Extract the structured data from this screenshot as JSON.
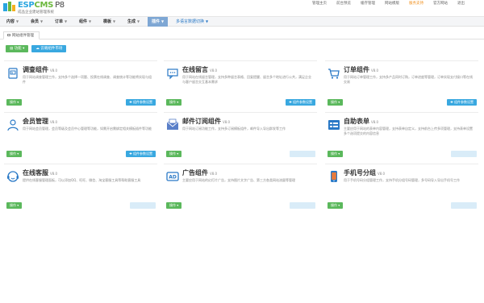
{
  "brand": {
    "logo_esp": "ESP",
    "logo_cms": "CMS",
    "logo_version": "P8",
    "subtitle": "成品企业建站管理系统"
  },
  "top_links": [
    {
      "label": "管理主页",
      "highlight": false
    },
    {
      "label": "前台预览",
      "highlight": false
    },
    {
      "label": "缓存管理",
      "highlight": false
    },
    {
      "label": "网站模版",
      "highlight": false
    },
    {
      "label": "服务支持",
      "highlight": true
    },
    {
      "label": "官方网站",
      "highlight": false
    },
    {
      "label": "退出",
      "highlight": false
    }
  ],
  "nav": {
    "items": [
      "内容",
      "会员",
      "订单",
      "组件",
      "模板",
      "生成"
    ],
    "active": "插件",
    "language": "多语言数据切换"
  },
  "tab": {
    "label": "网站组件管理"
  },
  "toolbar": {
    "primary": "功能",
    "secondary": "云端组件市场"
  },
  "cards": [
    {
      "title": "调查组件",
      "version": "V8.0",
      "desc": "用于网站调查管理工作，支持多个选择一项题、投票在线调查、调查统计等功能将实现与组件",
      "op": "操作",
      "param": "组件参数设置",
      "param_enabled": true,
      "icon": "survey-icon"
    },
    {
      "title": "在线留言",
      "version": "V8.0",
      "desc": "用于网站在线留言管理，支持多种留言表格、回复提醒、留言多个地址进行公共，满足企业与客户留言交互基本需求",
      "op": "操作",
      "param": "组件参数设置",
      "param_enabled": true,
      "icon": "message-icon"
    },
    {
      "title": "订单组件",
      "version": "V8.0",
      "desc": "用于网站订单管理工作，支持多产品同时订购，订单进度等管理，订单实现支付接口等在线交易",
      "op": "操作",
      "param": "组件参数设置",
      "param_enabled": true,
      "icon": "cart-icon"
    },
    {
      "title": "会员管理",
      "version": "V8.0",
      "desc": "用于网站会员管理，会员等级及会员中心管理等功能，如需开启需绑定相关模板插件等功能",
      "op": "操作",
      "param": "组件参数设置",
      "param_enabled": true,
      "icon": "member-icon"
    },
    {
      "title": "邮件订阅组件",
      "version": "V8.0",
      "desc": "用于网站订阅功能工作，支持多订阅模板组件，邮件导入导出群发等工作",
      "op": "操作",
      "param": "组件参数设置",
      "param_enabled": false,
      "icon": "mail-icon"
    },
    {
      "title": "自助表单",
      "version": "V8.0",
      "desc": "主要应用于网站的表单内容管理，支持表单自定义，支持前台上传多项管理，支持表单设置多个选项提交的内容信息",
      "op": "操作",
      "param": "组件参数设置",
      "param_enabled": false,
      "icon": "form-icon"
    },
    {
      "title": "在线客服",
      "version": "V8.0",
      "desc": "提供在线客服管理面板，可以添加QQ、旺旺、微信、淘宝客服工具等帮助客服工具",
      "op": "操作",
      "param": "组件参数设置",
      "param_enabled": false,
      "icon": "service-icon"
    },
    {
      "title": "广告组件",
      "version": "V8.0",
      "desc": "主要应用于网站的幻灯片广告，支持图片文字广告、第三方各类网站流量等管理",
      "op": "操作",
      "param": "组件参数设置",
      "param_enabled": false,
      "icon": "ad-icon"
    },
    {
      "title": "手机号分组",
      "version": "V8.0",
      "desc": "用于手机号码分组管理工作，支持手机分组号码管理，多号码导入导出手机号工作",
      "op": "操作",
      "param": "组件参数设置",
      "param_enabled": false,
      "icon": "phone-icon"
    }
  ],
  "colors": {
    "accent_blue": "#39a8e0",
    "accent_green": "#5bb85c",
    "nav_active": "#7ea7d4",
    "highlight_orange": "#f08c16"
  }
}
